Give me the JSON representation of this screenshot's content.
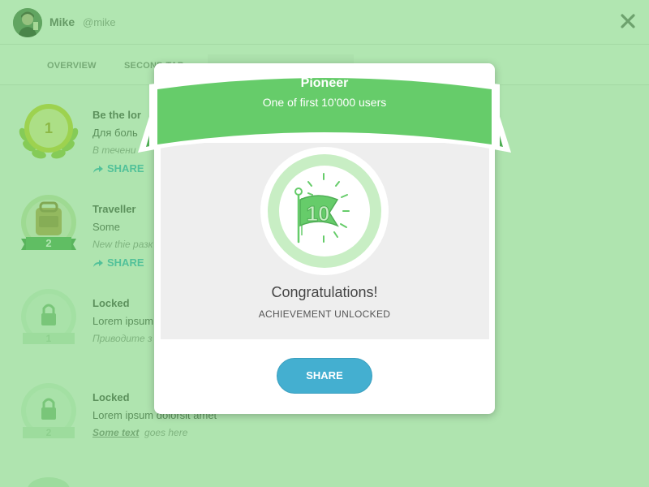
{
  "profile": {
    "name": "Mike",
    "handle": "@mike",
    "avatar_icon": "user-avatar",
    "close_icon": "close-icon"
  },
  "tabs": [
    {
      "label": "OVERVIEW"
    },
    {
      "label": "SECOND TAB"
    }
  ],
  "achievements": [
    {
      "title": "Be the lor",
      "description": "Для боль",
      "note": "В течени",
      "share_label": "SHARE",
      "badge_number": "1",
      "badge_icon": "laurel-wreath-icon"
    },
    {
      "title": "Traveller",
      "description": "Some",
      "note": "New thie разк",
      "share_label": "SHARE",
      "badge_number": "2",
      "badge_icon": "backpack-icon"
    },
    {
      "title": "Locked",
      "description": "Lorem ipsum",
      "note": "Приводите з",
      "badge_number": "1",
      "badge_icon": "lock-icon"
    },
    {
      "title": "Locked",
      "description": "Lorem ipsum dolorsit amet",
      "note_link": "Some text",
      "note_rest": "goes here",
      "badge_number": "2",
      "badge_icon": "lock-icon"
    }
  ],
  "modal": {
    "title": "Pioneer",
    "subtitle": "One of first 10’000 users",
    "medal_icon": "flag-10-icon",
    "congrats": "Congratulations!",
    "status": "ACHIEVEMENT UNLOCKED",
    "share_label": "SHARE"
  },
  "colors": {
    "overlay": "#64cd64",
    "ribbon_green": "#66cc6a",
    "ribbon_dark": "#4fae55",
    "medal_ring": "#c8eec4",
    "share_button": "#44afd0",
    "share_link": "#3fb5cf"
  }
}
